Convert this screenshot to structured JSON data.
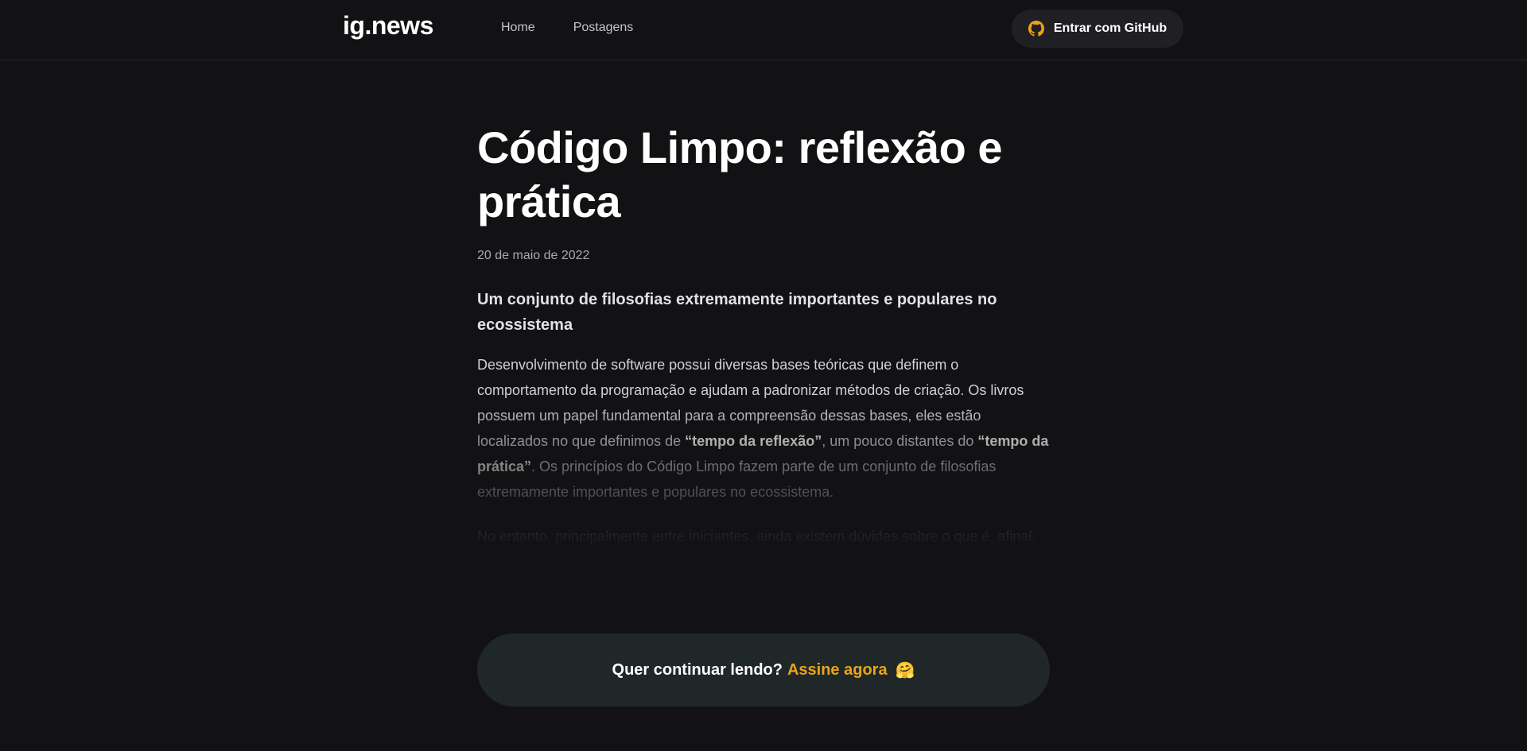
{
  "header": {
    "logo": "ig.news",
    "nav": [
      {
        "label": "Home"
      },
      {
        "label": "Postagens"
      }
    ],
    "signin_label": "Entrar com GitHub",
    "signin_icon": "github-icon",
    "signin_icon_color": "#eba417"
  },
  "article": {
    "title": "Código Limpo: reflexão e prática",
    "date": "20 de maio de 2022",
    "subtitle": "Um conjunto de filosofias extremamente importantes e populares no ecossistema",
    "paragraph1": {
      "part1": "Desenvolvimento de software possui diversas bases teóricas que definem o comportamento da programação e ajudam a padronizar métodos de criação. Os livros possuem um papel fundamental para a compreensão dessas bases, eles estão localizados no que definimos de ",
      "bold1": "“tempo da reflexão”",
      "part2": ", um pouco distantes do ",
      "bold2": "“tempo da prática”",
      "part3": ". Os princípios do Código Limpo fazem parte de um conjunto de filosofias extremamente importantes e populares no ecossistema."
    },
    "paragraph2": "No entanto, principalmente entre iniciantes, ainda existem dúvidas sobre o que é, afinal, um “código limpo” e o que ele representa na prática e na lógica do mercado."
  },
  "cta": {
    "question": "Quer continuar lendo?",
    "link": "Assine agora",
    "emoji": "🤗"
  },
  "colors": {
    "background": "#121214",
    "accent": "#eba417",
    "cta_background": "#1f2729"
  }
}
